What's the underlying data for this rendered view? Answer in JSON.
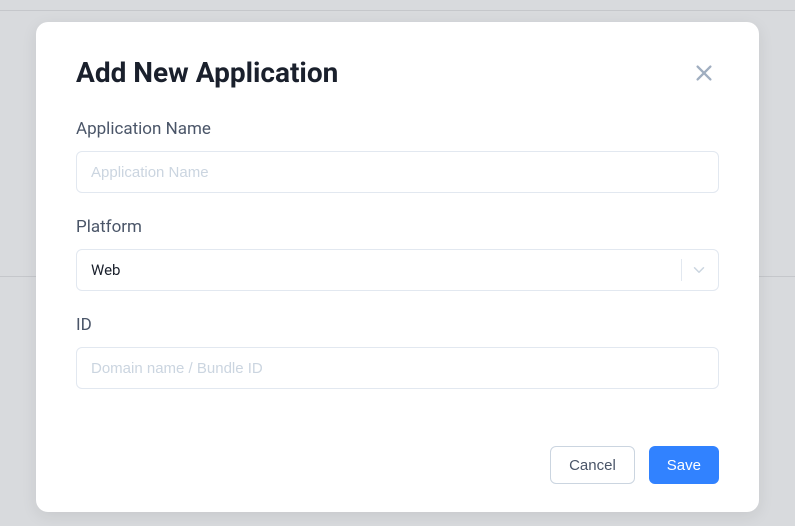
{
  "modal": {
    "title": "Add New Application",
    "fields": {
      "appName": {
        "label": "Application Name",
        "placeholder": "Application Name",
        "value": ""
      },
      "platform": {
        "label": "Platform",
        "selected": "Web"
      },
      "id": {
        "label": "ID",
        "placeholder": "Domain name / Bundle ID",
        "value": ""
      }
    },
    "buttons": {
      "cancel": "Cancel",
      "save": "Save"
    }
  }
}
